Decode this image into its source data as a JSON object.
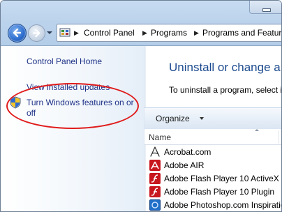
{
  "address": {
    "crumbs": [
      "Control Panel",
      "Programs",
      "Programs and Features"
    ]
  },
  "sidebar": {
    "home": "Control Panel Home",
    "view_updates": "View installed updates",
    "windows_features_line1": "Turn Windows features on or",
    "windows_features_line2": "off"
  },
  "main": {
    "title": "Uninstall or change a program",
    "description": "To uninstall a program, select it from the list and then click Uninstall, Change, or Repair.",
    "organize": "Organize",
    "column_name": "Name",
    "programs": [
      "Acrobat.com",
      "Adobe AIR",
      "Adobe Flash Player 10 ActiveX",
      "Adobe Flash Player 10 Plugin",
      "Adobe Photoshop.com Inspiration Browser"
    ]
  },
  "icons": {
    "back": "back-arrow-icon",
    "forward": "forward-arrow-icon",
    "address": "control-panel-icon",
    "shield": "uac-shield-icon"
  },
  "colors": {
    "link": "#1e3287",
    "title": "#1c4a8f",
    "highlight_ellipse": "#e01b1b"
  }
}
